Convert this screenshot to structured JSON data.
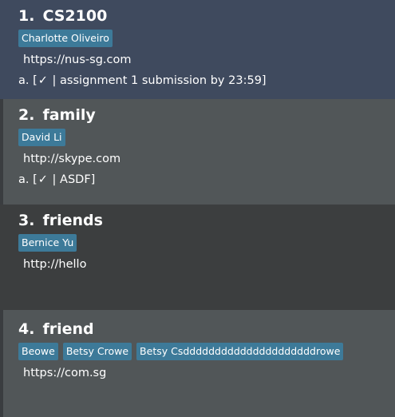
{
  "groups": [
    {
      "index": "1.",
      "name": "CS2100",
      "tags": [
        "Charlotte Oliveiro"
      ],
      "link": "https://nus-sg.com",
      "todo": {
        "letter": "a.",
        "open": "[",
        "check": "✓",
        "text": "| assignment 1 submission by 23:59]"
      }
    },
    {
      "index": "2.",
      "name": "family",
      "tags": [
        "David Li"
      ],
      "link": "http://skype.com",
      "todo": {
        "letter": "a.",
        "open": "[",
        "check": "✓",
        "text": "| ASDF]"
      }
    },
    {
      "index": "3.",
      "name": "friends",
      "tags": [
        "Bernice Yu"
      ],
      "link": "http://hello"
    },
    {
      "index": "4.",
      "name": "friend",
      "tags": [
        "Beowe",
        "Betsy Crowe",
        "Betsy Csdddddddddddddddddddddrowe"
      ],
      "link": "https://com.sg"
    }
  ]
}
